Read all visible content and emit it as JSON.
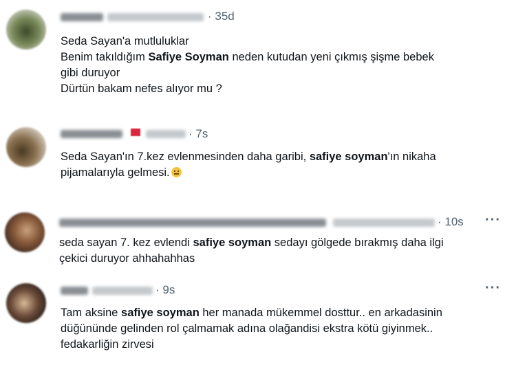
{
  "tweets": [
    {
      "time": "· 35d",
      "lines": [
        [
          {
            "t": "Seda Sayan'a mutluluklar"
          }
        ],
        [
          {
            "t": "Benim takıldığım "
          },
          {
            "t": "Safiye Soyman",
            "b": true
          },
          {
            "t": " neden kutudan yeni çıkmış şişme bebek"
          }
        ],
        [
          {
            "t": "gibi duruyor"
          }
        ],
        [
          {
            "t": "Dürtün bakam nefes alıyor mu ?"
          }
        ]
      ]
    },
    {
      "time": "· 7s",
      "lines": [
        [
          {
            "t": "Seda Sayan'ın 7.kez evlenmesinden daha garibi, "
          },
          {
            "t": "safiye soyman",
            "b": true
          },
          {
            "t": "'ın nikaha"
          }
        ],
        [
          {
            "t": "pijamalarıyla gelmesi."
          },
          {
            "emoji": "grimace-emoji"
          }
        ]
      ]
    },
    {
      "time": "· 10s",
      "more": "···",
      "lines": [
        [
          {
            "t": "seda sayan 7. kez evlendi "
          },
          {
            "t": "safiye soyman",
            "b": true
          },
          {
            "t": " sedayı gölgede bırakmış daha ilgi"
          }
        ],
        [
          {
            "t": "çekici duruyor ahhahahhas"
          }
        ]
      ]
    },
    {
      "time": "· 9s",
      "more": "···",
      "lines": [
        [
          {
            "t": "Tam aksine "
          },
          {
            "t": "safiye soyman",
            "b": true
          },
          {
            "t": " her manada mükemmel dosttur.. en arkadasinin"
          }
        ],
        [
          {
            "t": "düğününde gelinden rol çalmamak adına olağandisi ekstra kötü giyinmek.."
          }
        ],
        [
          {
            "t": "fedakarliğin zirvesi"
          }
        ]
      ]
    }
  ],
  "colors": {
    "text": "#0f1419",
    "muted": "#536471"
  }
}
